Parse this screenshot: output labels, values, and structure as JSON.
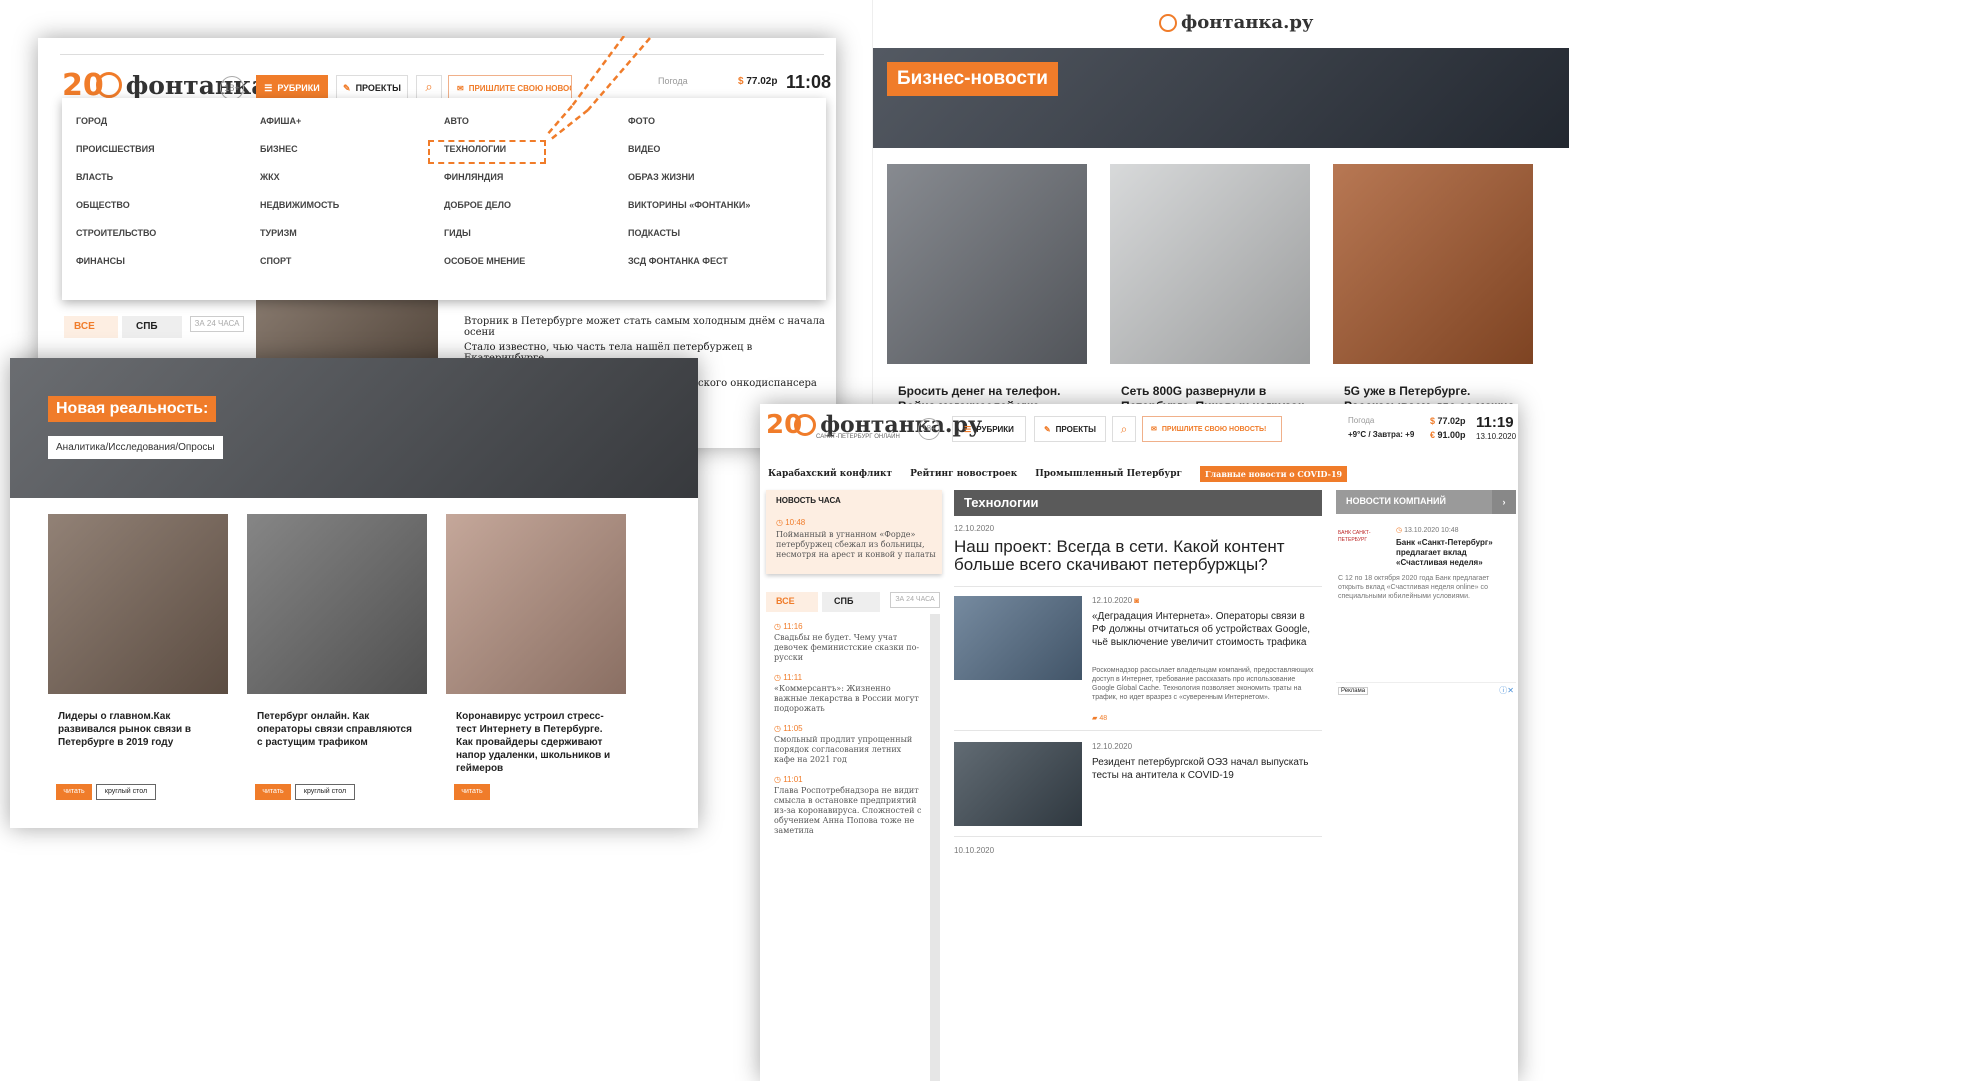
{
  "brand": {
    "logo_text": "фонтанка.ру",
    "logo_sub": "САНКТ-ПЕТЕРБУРГ ОНЛАЙН",
    "logo_num": "20",
    "age": "18+"
  },
  "panel1": {
    "nav": {
      "rubrics": "РУБРИКИ",
      "projects": "ПРОЕКТЫ",
      "send_news": "ПРИШЛИТЕ СВОЮ НОВОСТЬ!",
      "weather_label": "Погода",
      "usd": "77.02р",
      "time": "11:08"
    },
    "menu": [
      [
        "ГОРОД",
        "ПРОИСШЕСТВИЯ",
        "ВЛАСТЬ",
        "ОБЩЕСТВО",
        "СТРОИТЕЛЬСТВО",
        "ФИНАНСЫ"
      ],
      [
        "АФИША+",
        "БИЗНЕС",
        "ЖКХ",
        "НЕДВИЖИМОСТЬ",
        "ТУРИЗМ",
        "СПОРТ"
      ],
      [
        "АВТО",
        "ТЕХНОЛОГИИ",
        "ФИНЛЯНДИЯ",
        "ДОБРОЕ ДЕЛО",
        "ГИДЫ",
        "ОСОБОЕ МНЕНИЕ"
      ],
      [
        "ФОТО",
        "ВИДЕО",
        "ОБРАЗ ЖИЗНИ",
        "ВИКТОРИНЫ «ФОНТАНКИ»",
        "ПОДКАСТЫ",
        "ЗСД ФОНТАНКА ФЕСТ"
      ]
    ],
    "tabs": {
      "all": "ВСЕ",
      "spb": "СПБ",
      "day": "ЗА 24 ЧАСА"
    },
    "headlines": [
      "Вторник в Петербурге может стать самым холодным днём с начала осени",
      "Стало известно, чью часть тела нашёл петербуржец в Екатеринбурге.",
      "ского онкодиспансера"
    ]
  },
  "panel2": {
    "banner_title": "Бизнес-новости",
    "cards": [
      "Бросить денег на телефон. Война мегакиселей уже",
      "Сеть 800G развернули в Петербурге. Пиковых нагрузок",
      "5G уже в Петербурге. Рассказываем, где ее можно"
    ]
  },
  "panel3": {
    "banner_title": "Новая реальность:",
    "banner_sub": "Аналитика/Исследования/Опросы",
    "cards": [
      {
        "title": "Лидеры о главном.Как развивался рынок связи в Петербурге в 2019 году",
        "read": "читать",
        "tag": "круглый стол"
      },
      {
        "title": "Петербург онлайн. Как операторы связи справляются с растущим трафиком",
        "read": "читать",
        "tag": "круглый стол"
      },
      {
        "title": "Коронавирус устроил стресс-тест Интернету в Петербурге. Как провайдеры сдерживают напор удаленки, школьников и геймеров",
        "read": "читать",
        "tag": ""
      }
    ]
  },
  "panel4": {
    "nav": {
      "rubrics": "РУБРИКИ",
      "projects": "ПРОЕКТЫ",
      "send_news": "ПРИШЛИТЕ СВОЮ НОВОСТЬ!",
      "weather_label": "Погода",
      "weather": "+9°С / Завтра: +9",
      "usd": "77.02р",
      "eur": "91.00р",
      "time": "11:19",
      "date": "13.10.2020"
    },
    "topics": [
      "Карабахский конфликт",
      "Рейтинг новостроек",
      "Промышленный Петербург",
      "Главные новости о COVID-19"
    ],
    "hour_news": {
      "label": "НОВОСТЬ ЧАСА",
      "time": "10:48",
      "text": "Пойманный в угнанном «Форде» петербуржец сбежал из больницы, несмотря на арест и конвой у палаты"
    },
    "tabs": {
      "all": "ВСЕ",
      "spb": "СПБ",
      "day": "ЗА 24 ЧАСА"
    },
    "feed": [
      {
        "time": "11:16",
        "text": "Свадьбы не будет. Чему учат девочек феминистские сказки по-русски"
      },
      {
        "time": "11:11",
        "text": "«Коммерсантъ»: Жизненно важные лекарства в России могут подорожать"
      },
      {
        "time": "11:05",
        "text": "Смольный продлит упрощенный порядок согласования летних кафе на 2021 год"
      },
      {
        "time": "11:01",
        "text": "Глава Роспотребнадзора не видит смысла в остановке предприятий из-за коронавируса. Сложностей с обучением Анна Попова тоже не заметила"
      }
    ],
    "section_title": "Технологии",
    "lead": {
      "date": "12.10.2020",
      "title": "Наш проект: Всегда в сети. Какой контент больше всего скачивают петербуржцы?"
    },
    "articles": [
      {
        "date": "12.10.2020",
        "title": "«Деградация Интернета». Операторы связи в РФ должны отчитаться об устройствах Google, чьё выключение увеличит стоимость трафика",
        "text": "Роскомнадзор рассылает владельцам компаний, предоставляющих доступ в Интернет, требование рассказать про использование Google Global Cache. Технология позволяет экономить траты на трафик, но идет вразрез с «суверенным Интернетом».",
        "comments": "48"
      },
      {
        "date": "12.10.2020",
        "title": "Резидент петербургской ОЭЗ начал выпускать тесты на антитела к COVID-19",
        "text": "",
        "comments": ""
      }
    ],
    "next_date": "10.10.2020",
    "company": {
      "label": "НОВОСТИ КОМПАНИЙ",
      "datetime": "13.10.2020 10:48",
      "bank": "БАНК САНКТ-ПЕТЕРБУРГ",
      "title": "Банк «Санкт-Петербург» предлагает вклад «Счастливая неделя»",
      "text": "С 12 по 18 октября 2020 года Банк предлагает открыть вклад «Счастливая неделя online» со специальными юбилейными условиями."
    },
    "ad_label": "Реклама"
  },
  "colors": {
    "accent": "#f07c2a",
    "dark_bar": "#5a5a5a",
    "grey_bar": "#9a9a9a"
  }
}
